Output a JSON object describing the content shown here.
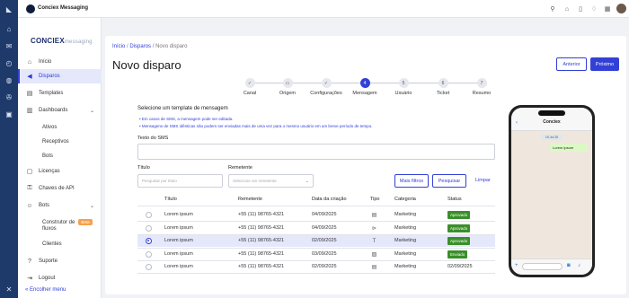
{
  "rail": {
    "icons": [
      "logo-icon",
      "home-icon",
      "mail-icon",
      "history-icon",
      "analytics-icon",
      "support-icon",
      "package-icon"
    ],
    "bottom_icon": "x-icon"
  },
  "topbar": {
    "app_name": "Conciex Messaging",
    "icons": [
      "search-icon",
      "home-icon",
      "file-icon",
      "bell-icon",
      "apps-grid-icon",
      "user-icon"
    ]
  },
  "sidebar": {
    "brand_main": "CONCIEX",
    "brand_sub": "messaging",
    "items": [
      {
        "label": "Início",
        "icon": "home-icon"
      },
      {
        "label": "Disparos",
        "icon": "megaphone-icon",
        "active": true
      },
      {
        "label": "Templates",
        "icon": "document-icon"
      },
      {
        "label": "Dashboards",
        "icon": "dashboard-icon",
        "expandable": true
      },
      {
        "label": "Licenças",
        "icon": "license-icon"
      },
      {
        "label": "Chaves de API",
        "icon": "key-icon"
      },
      {
        "label": "Bots",
        "icon": "bot-icon",
        "expandable": true
      },
      {
        "label": "Suporte",
        "icon": "help-icon"
      },
      {
        "label": "Logout",
        "icon": "logout-icon"
      }
    ],
    "dashboard_sub": [
      "Ativos",
      "Receptivos",
      "Bots"
    ],
    "bots_sub": [
      "Construtor de",
      "fluxos",
      "Clientes"
    ],
    "beta": "Beta",
    "collapse": "Encolher menu"
  },
  "main": {
    "breadcrumb": {
      "home": "Início",
      "sep1": "/",
      "section": "Disparos",
      "sep2": "/",
      "current": "Novo disparo"
    },
    "title": "Novo disparo",
    "btn_prev": "Anterior",
    "btn_next": "Próximo",
    "steps": [
      {
        "label": "Canal",
        "mark": "✓"
      },
      {
        "label": "Origem",
        "mark": "▭"
      },
      {
        "label": "Configurações",
        "mark": "✓"
      },
      {
        "label": "Mensagem",
        "mark": "4",
        "current": true
      },
      {
        "label": "Usuário",
        "mark": "5"
      },
      {
        "label": "Ticket",
        "mark": "6"
      },
      {
        "label": "Resumo",
        "mark": "7"
      }
    ],
    "section_title": "Selecione um template de mensagem",
    "notes": [
      "• Em casos de SMS, a mensagem pode ser editada.",
      "• Mensagens de SMS idênticas não podem ser enviadas mais de uma vez para o mesmo usuário em um breve período de tempo."
    ],
    "sms_label": "Texto do SMS",
    "filter_title_label": "Título",
    "filter_title_placeholder": "Pesquisar por título",
    "filter_sender_label": "Remetente",
    "filter_sender_placeholder": "Selecione um remetente",
    "btn_more_filters": "Mais filtros",
    "btn_search": "Pesquisar",
    "btn_clear": "Limpar",
    "table": {
      "headers": [
        "Título",
        "Remetente",
        "Data da criação",
        "Tipo",
        "Categoria",
        "Status"
      ],
      "rows": [
        {
          "title": "Lorem ipsum",
          "sender": "+55 (11) 98765-4321",
          "date": "04/09/2025",
          "type_icon": "document-icon",
          "category": "Marketing",
          "status": "Aprovado",
          "status_color": "#3a8f2a",
          "selected": false
        },
        {
          "title": "Lorem ipsum",
          "sender": "+55 (11) 98765-4321",
          "date": "04/09/2025",
          "type_icon": "play-icon",
          "category": "Marketing",
          "status": "Aprovado",
          "status_color": "#3a8f2a",
          "selected": false
        },
        {
          "title": "Lorem ipsum",
          "sender": "+55 (11) 98765-4321",
          "date": "02/09/2025",
          "type_icon": "text-icon",
          "category": "Marketing",
          "status": "Aprovado",
          "status_color": "#3a8f2a",
          "selected": true
        },
        {
          "title": "Lorem ipsum",
          "sender": "+55 (11) 98765-4321",
          "date": "03/09/2025",
          "type_icon": "image-icon",
          "category": "Marketing",
          "status": "Enviado",
          "status_color": "#3a8f2a",
          "selected": false
        },
        {
          "title": "Lorem ipsum",
          "sender": "+55 (11) 98765-4321",
          "date": "02/09/2025",
          "type_icon": "document-icon",
          "category": "Marketing",
          "status": "02/09/2025",
          "status_color": null,
          "selected": false
        }
      ]
    }
  },
  "phone": {
    "contact": "Conciex",
    "date_chip": "15 Jul 25",
    "message": "Lorem ipsum"
  },
  "colors": {
    "accent": "#3340d6",
    "rail": "#1e3a6b",
    "approved": "#3a8f2a"
  }
}
